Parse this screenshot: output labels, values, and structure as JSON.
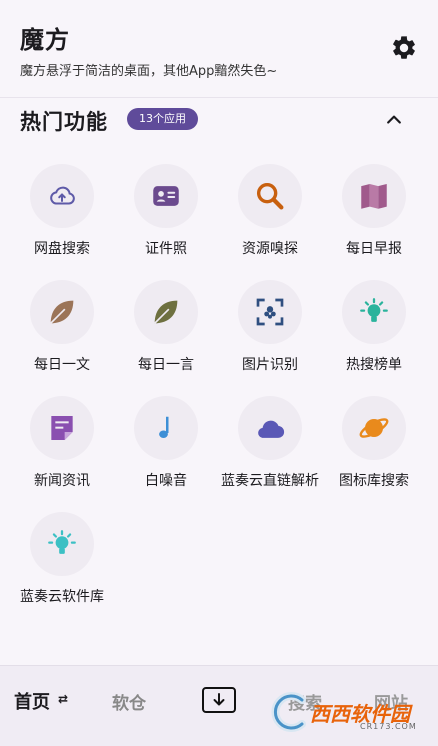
{
  "header": {
    "title": "魔方",
    "subtitle": "魔方悬浮于简洁的桌面，其他App黯然失色~",
    "settings_icon": "gear-icon"
  },
  "section": {
    "title": "热门功能",
    "badge": "13个应用",
    "collapse_icon": "chevron-up-icon"
  },
  "apps": [
    {
      "label": "网盘搜索",
      "icon": "cloud-upload-icon",
      "color": "#5e5aa8"
    },
    {
      "label": "证件照",
      "icon": "id-card-icon",
      "color": "#6b4a8e"
    },
    {
      "label": "资源嗅探",
      "icon": "magnifier-icon",
      "color": "#c8600f"
    },
    {
      "label": "每日早报",
      "icon": "book-icon",
      "color": "#a05a8c"
    },
    {
      "label": "每日一文",
      "icon": "leaf-icon",
      "color": "#9b7458"
    },
    {
      "label": "每日一言",
      "icon": "leaf-icon",
      "color": "#6e7040"
    },
    {
      "label": "图片识别",
      "icon": "scan-icon",
      "color": "#2f4f80"
    },
    {
      "label": "热搜榜单",
      "icon": "bulb-icon",
      "color": "#2ab39c"
    },
    {
      "label": "新闻资讯",
      "icon": "note-icon",
      "color": "#8a4fb0"
    },
    {
      "label": "白噪音",
      "icon": "music-note-icon",
      "color": "#3d8fd6"
    },
    {
      "label": "蓝奏云直链解析",
      "icon": "cloud-icon",
      "color": "#5a58b6"
    },
    {
      "label": "图标库搜索",
      "icon": "planet-icon",
      "color": "#e98a1c"
    },
    {
      "label": "蓝奏云软件库",
      "icon": "bulb-icon",
      "color": "#3cc0c4"
    }
  ],
  "bottom_nav": {
    "home": "首页",
    "swap": "⇄",
    "store": "软仓",
    "download_icon": "download-icon",
    "search": "搜索",
    "site": "网站"
  },
  "watermark": {
    "text": "西西软件园",
    "site": "CR173.COM"
  }
}
